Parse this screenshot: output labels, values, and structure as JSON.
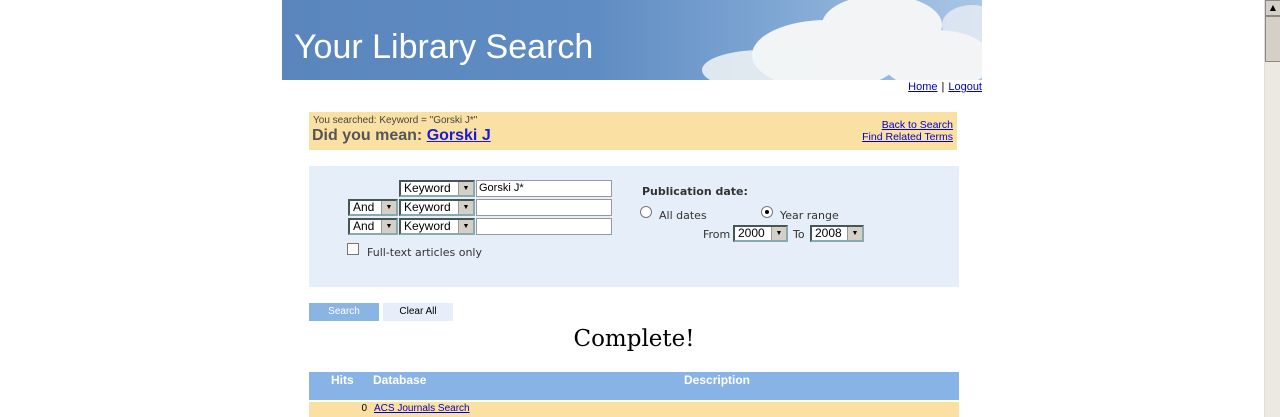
{
  "header": {
    "title": "Your Library Search",
    "home_link": "Home",
    "separator": "|",
    "logout_link": "Logout"
  },
  "did_you_mean": {
    "searched_text": "You searched:  Keyword = \"Gorski J*\"",
    "prompt": "Did you mean:",
    "suggestion": "Gorski J",
    "back_link": "Back to Search",
    "related_link": "Find Related Terms"
  },
  "search_form": {
    "rows": [
      {
        "operator": "",
        "field": "Keyword",
        "value": "Gorski J*"
      },
      {
        "operator": "And",
        "field": "Keyword",
        "value": ""
      },
      {
        "operator": "And",
        "field": "Keyword",
        "value": ""
      }
    ],
    "fulltext_label": "Full-text articles only",
    "pub_date_label": "Publication date:",
    "all_dates_label": "All dates",
    "year_range_label": "Year range",
    "from_label": "From",
    "from_value": "2000",
    "to_label": "To",
    "to_value": "2008"
  },
  "buttons": {
    "search": "Search",
    "clear": "Clear All"
  },
  "status": "Complete!",
  "results": {
    "columns": [
      "Hits",
      "Database",
      "Description"
    ],
    "rows": [
      {
        "hits": "0",
        "database": "ACS Journals Search"
      }
    ]
  },
  "colors": {
    "banner": "#5f8cc3",
    "highlight": "#fbe0a3",
    "panel": "#e6eff9",
    "table_header": "#88b3e6"
  }
}
